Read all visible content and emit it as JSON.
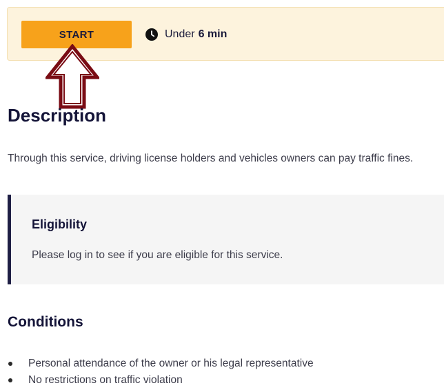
{
  "start_bar": {
    "start_label": "START",
    "duration_prefix": "Under",
    "duration_value": "6 min"
  },
  "description": {
    "title": "Description",
    "text": "Through this service, driving license holders and vehicles owners can pay traffic fines."
  },
  "eligibility": {
    "title": "Eligibility",
    "text": "Please log in to see if you are eligible for this service."
  },
  "conditions": {
    "title": "Conditions",
    "items": [
      "Personal attendance of the owner or his legal representative",
      "No restrictions on traffic violation"
    ]
  },
  "colors": {
    "start_button": "#f7a21b",
    "start_bar_bg": "#fdf3dd",
    "arrow": "#7a0c14",
    "heading": "#141438"
  },
  "icons": {
    "duration": "clock-icon",
    "annotation": "up-arrow-annotation"
  }
}
